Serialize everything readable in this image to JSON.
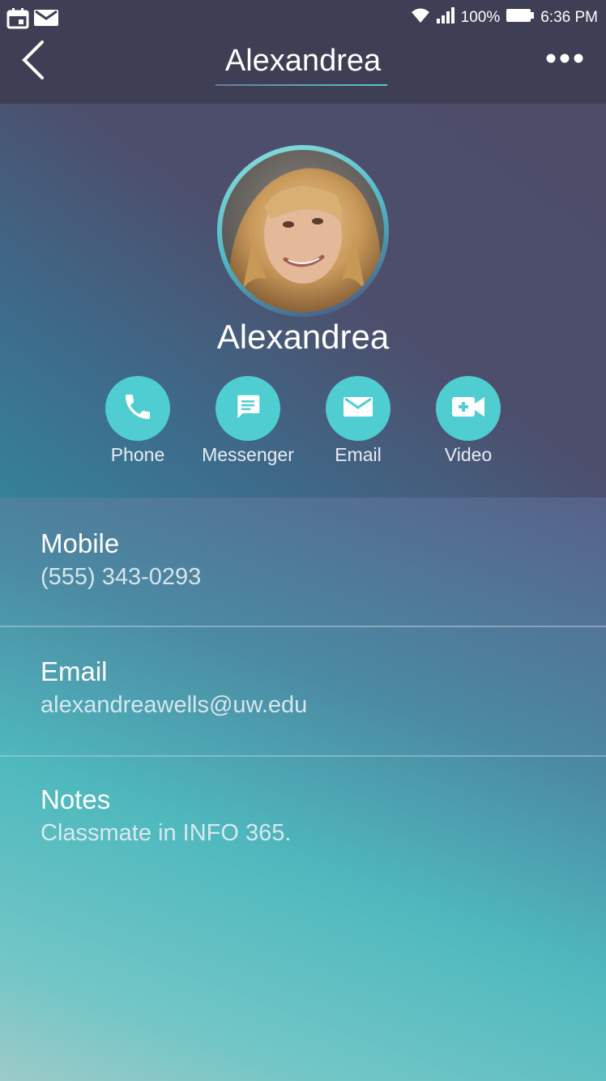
{
  "status_bar": {
    "battery_percent": "100%",
    "time": "6:36 PM",
    "left_icons": [
      "calendar-icon",
      "mail-icon"
    ],
    "right_icons": [
      "wifi-icon",
      "signal-icon",
      "battery-icon"
    ]
  },
  "nav": {
    "title": "Alexandrea",
    "back_icon": "chevron-left-icon",
    "more_icon": "more-dots-icon"
  },
  "profile": {
    "name": "Alexandrea",
    "avatar": "avatar"
  },
  "actions": [
    {
      "label": "Phone",
      "icon": "phone-icon"
    },
    {
      "label": "Messenger",
      "icon": "message-icon"
    },
    {
      "label": "Email",
      "icon": "mail-icon"
    },
    {
      "label": "Video",
      "icon": "video-icon"
    }
  ],
  "details": [
    {
      "label": "Mobile",
      "value": "(555) 343-0293"
    },
    {
      "label": "Email",
      "value": "alexandreawells@uw.edu"
    },
    {
      "label": "Notes",
      "value": "Classmate in INFO 365."
    }
  ],
  "colors": {
    "accent": "#4fcdd1",
    "header_bg": "#3e3e55"
  }
}
